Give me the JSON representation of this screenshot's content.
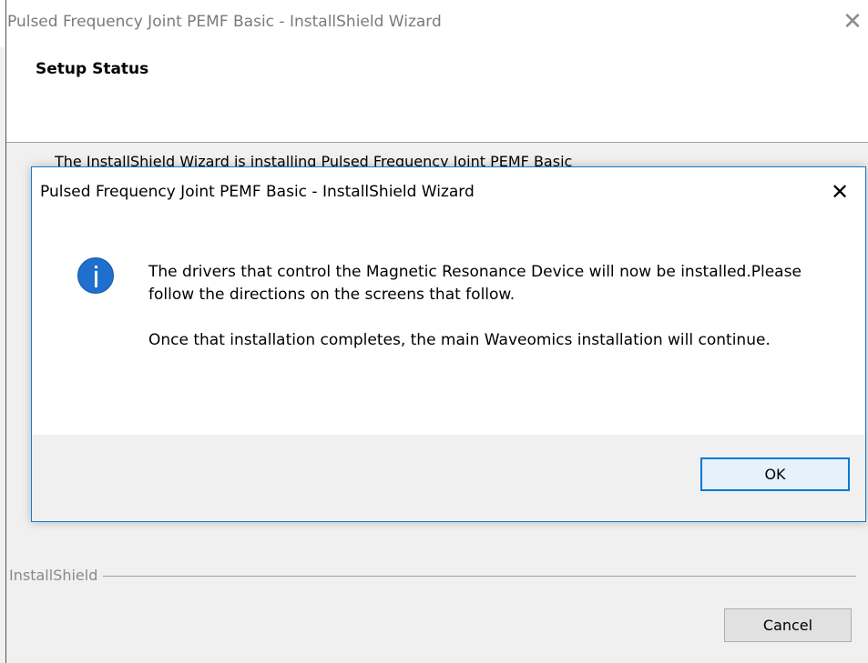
{
  "background_window": {
    "title": "Pulsed Frequency Joint PEMF Basic - InstallShield Wizard",
    "close_glyph": "✕",
    "header_title": "Setup Status",
    "body_text": "The InstallShield Wizard is installing Pulsed Frequency Joint PEMF Basic",
    "brand": "InstallShield",
    "cancel_label": "Cancel"
  },
  "dialog": {
    "title": "Pulsed Frequency Joint PEMF Basic - InstallShield Wizard",
    "close_glyph": "✕",
    "icon": "info-icon",
    "message_line1": "The drivers that control the Magnetic Resonance Device will now be installed.Please follow the directions on the screens that follow.",
    "message_line2": "Once that installation completes, the main Waveomics installation will continue.",
    "ok_label": "OK"
  },
  "colors": {
    "accent": "#0078d7",
    "info_icon": "#1f6fcf",
    "dialog_border": "#1979ca",
    "footer_bg": "#f0f0f0"
  }
}
